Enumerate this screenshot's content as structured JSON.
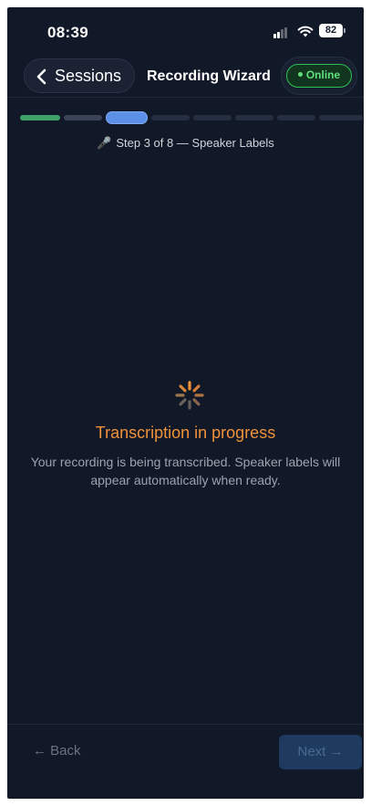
{
  "status_bar": {
    "time": "08:39",
    "battery": "82"
  },
  "header": {
    "back_label": "Sessions",
    "title": "Recording Wizard",
    "status_badge": "Online"
  },
  "wizard": {
    "step_label": "Step 3 of 8 — Speaker Labels",
    "current_step": 3,
    "total_steps": 8
  },
  "loading": {
    "title": "Transcription in progress",
    "description": "Your recording is being transcribed. Speaker labels will appear automatically when ready."
  },
  "footer": {
    "back_label": "← Back",
    "next_label": "Next →"
  },
  "colors": {
    "background": "#111827",
    "accent_orange": "#f0923a",
    "online_green": "#5de07b",
    "step_done": "#3fa06a",
    "step_current": "#5b8fe8"
  },
  "icons": {
    "back": "chevron-left-icon",
    "step": "microphone-icon",
    "loading": "spinner-icon"
  }
}
